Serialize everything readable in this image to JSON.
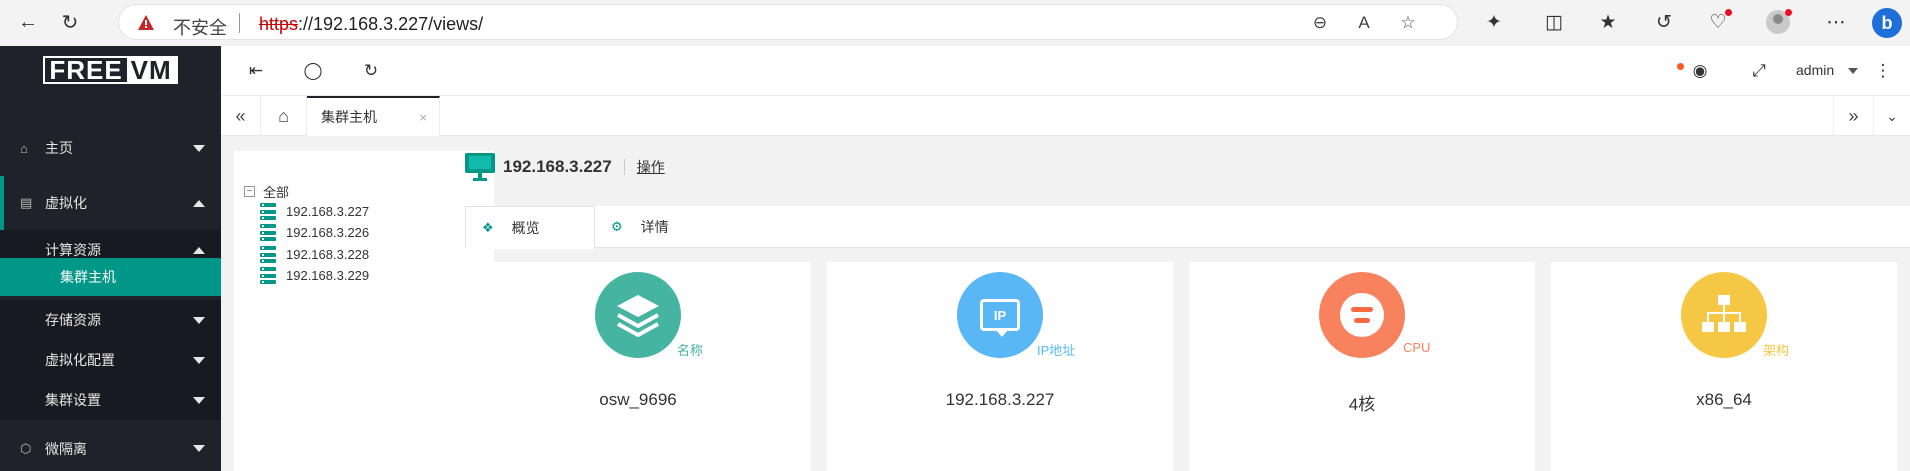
{
  "browser": {
    "security_label": "不安全",
    "url_protocol": "https",
    "url_rest": "://192.168.3.227/views/"
  },
  "app": {
    "logo_part1": "FREE",
    "logo_part2": "VM"
  },
  "sidebar": {
    "items": [
      {
        "label": "主页",
        "icon": "home-icon"
      },
      {
        "label": "虚拟化",
        "icon": "server-icon"
      },
      {
        "label": "计算资源"
      },
      {
        "label": "集群主机"
      },
      {
        "label": "存储资源"
      },
      {
        "label": "虚拟化配置"
      },
      {
        "label": "集群设置"
      },
      {
        "label": "微隔离",
        "icon": "cube-icon"
      }
    ]
  },
  "header": {
    "user": "admin"
  },
  "tabs": {
    "active_label": "集群主机",
    "close_label": "×"
  },
  "tree": {
    "root": "全部",
    "hosts": [
      "192.168.3.227",
      "192.168.3.226",
      "192.168.3.228",
      "192.168.3.229"
    ]
  },
  "host": {
    "title": "192.168.3.227",
    "operation": "操作",
    "tabs": [
      "概览",
      "详情"
    ]
  },
  "cards": [
    {
      "label": "名称",
      "value": "osw_9696",
      "color": "#45b4a0"
    },
    {
      "label": "IP地址",
      "value": "192.168.3.227",
      "color": "#5ab7f5"
    },
    {
      "label": "CPU",
      "value": "4核",
      "color": "#f9825e"
    },
    {
      "label": "架构",
      "value": "x86_64",
      "color": "#f6c744"
    }
  ],
  "colors": {
    "accent": "#009688",
    "sidebar_bg": "#20222a"
  }
}
